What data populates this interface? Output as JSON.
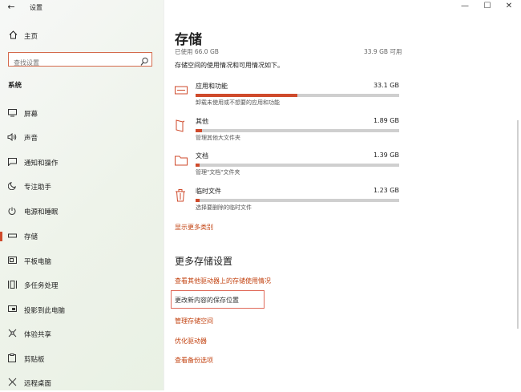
{
  "window": {
    "title": "设置",
    "back_symbol": "←",
    "controls": {
      "minimize": "—",
      "maximize": "☐",
      "close": "✕"
    }
  },
  "sidebar": {
    "home_label": "主页",
    "search_placeholder": "查找设置",
    "section_label": "系统",
    "items": [
      {
        "label": "屏幕",
        "icon": "display-icon",
        "active": false
      },
      {
        "label": "声音",
        "icon": "speaker-icon",
        "active": false
      },
      {
        "label": "通知和操作",
        "icon": "notification-icon",
        "active": false
      },
      {
        "label": "专注助手",
        "icon": "moon-icon",
        "active": false
      },
      {
        "label": "电源和睡眠",
        "icon": "power-icon",
        "active": false
      },
      {
        "label": "存储",
        "icon": "storage-icon",
        "active": true
      },
      {
        "label": "平板电脑",
        "icon": "tablet-icon",
        "active": false
      },
      {
        "label": "多任务处理",
        "icon": "multitask-icon",
        "active": false
      },
      {
        "label": "投影到此电脑",
        "icon": "project-icon",
        "active": false
      },
      {
        "label": "体验共享",
        "icon": "share-icon",
        "active": false
      },
      {
        "label": "剪贴板",
        "icon": "clipboard-icon",
        "active": false
      },
      {
        "label": "远程桌面",
        "icon": "remote-icon",
        "active": false
      }
    ]
  },
  "main": {
    "title": "存储",
    "used_label": "已使用 66.0 GB",
    "free_label": "33.9 GB 可用",
    "summary": "存储空间的使用情况和可用情况如下。",
    "categories": [
      {
        "name": "应用和功能",
        "size": "33.1 GB",
        "desc": "卸载未使用或不想要的应用和功能",
        "fraction": 0.5,
        "icon": "apps-icon"
      },
      {
        "name": "其他",
        "size": "1.89 GB",
        "desc": "管理其他大文件夹",
        "fraction": 0.03,
        "icon": "other-icon"
      },
      {
        "name": "文档",
        "size": "1.39 GB",
        "desc": "管理\"文档\"文件夹",
        "fraction": 0.02,
        "icon": "folder-icon"
      },
      {
        "name": "临时文件",
        "size": "1.23 GB",
        "desc": "选择要删除的临时文件",
        "fraction": 0.02,
        "icon": "trash-icon"
      }
    ],
    "show_more": "显示更多类别",
    "more_settings_title": "更多存储设置",
    "links": {
      "other_drives": "查看其他驱动器上的存储使用情况",
      "change_location": "更改新内容的保存位置",
      "manage_spaces": "管理存储空间",
      "optimize_drives": "优化驱动器",
      "backup_options": "查看备份选项"
    }
  },
  "colors": {
    "accent": "#cf4a2b",
    "link": "#c2410f",
    "highlight_border": "#e06a5a"
  }
}
